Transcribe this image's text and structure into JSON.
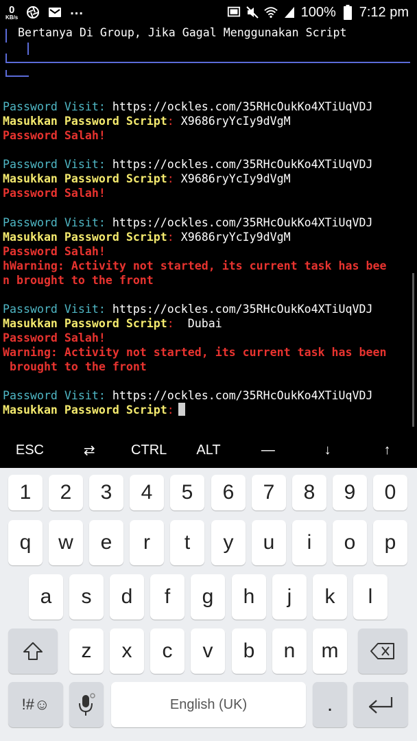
{
  "status_bar": {
    "speed_value": "0",
    "speed_unit": "KB/s",
    "battery": "100%",
    "time": "7:12 pm",
    "icons": [
      "aperture-icon",
      "mail-icon",
      "cast-icon",
      "mute-icon",
      "wifi-icon",
      "signal-icon",
      "battery-icon"
    ]
  },
  "terminal": {
    "banner": "Bertanya Di Group, Jika Gagal Menggunakan Script",
    "accent_color": "#5b6bd8",
    "label_visit": "Password Visit",
    "label_script": "Masukkan Password Script",
    "url": "https://ockles.com/35RHcOukKo4XTiUqVDJ",
    "password_1": "X9686ryYcIy9dVgM",
    "password_2": "X9686ryYcIy9dVgM",
    "password_3": "X9686ryYcIy9dVgM",
    "password_4": " Dubai",
    "wrong": "Password Salah!",
    "warning_a1": "hWarning: Activity not started, its current task has bee",
    "warning_a2": "n brought to the front",
    "warning_b1": "Warning: Activity not started, its current task has been",
    "warning_b2": " brought to the front"
  },
  "extra_keys": [
    "ESC",
    "⇄",
    "CTRL",
    "ALT",
    "—",
    "↓",
    "↑"
  ],
  "keyboard": {
    "row_numbers": [
      "1",
      "2",
      "3",
      "4",
      "5",
      "6",
      "7",
      "8",
      "9",
      "0"
    ],
    "row_top": [
      "q",
      "w",
      "e",
      "r",
      "t",
      "y",
      "u",
      "i",
      "o",
      "p"
    ],
    "row_home": [
      "a",
      "s",
      "d",
      "f",
      "g",
      "h",
      "j",
      "k",
      "l"
    ],
    "row_bottom": [
      "z",
      "x",
      "c",
      "v",
      "b",
      "n",
      "m"
    ],
    "symbols_label": "!#☺",
    "space_label": "English (UK)",
    "period": "."
  }
}
